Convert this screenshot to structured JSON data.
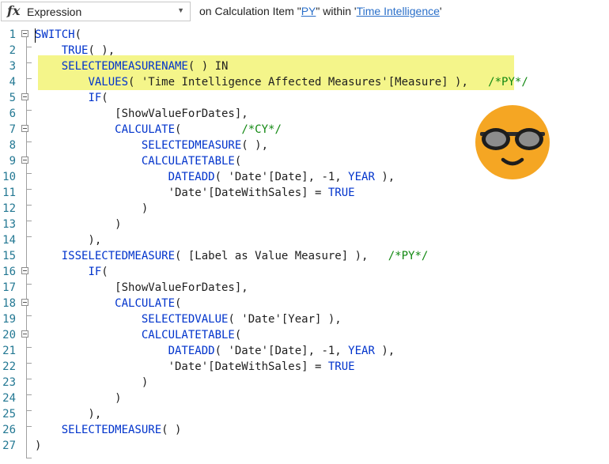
{
  "header": {
    "dropdown_label": "Expression",
    "context_prefix": "on Calculation Item \"",
    "item_name": "PY",
    "context_middle": "\" within '",
    "group_name": "Time Intelligence",
    "context_suffix": "'"
  },
  "editor": {
    "highlight_color": "#f4f58a",
    "lines": [
      {
        "n": "1",
        "t": [
          {
            "k": "kw",
            "s": "SWITCH"
          },
          {
            "s": "("
          }
        ]
      },
      {
        "n": "2",
        "t": [
          {
            "s": "    "
          },
          {
            "k": "kw",
            "s": "TRUE"
          },
          {
            "s": "( ),"
          }
        ]
      },
      {
        "n": "3",
        "t": [
          {
            "s": "    "
          },
          {
            "k": "kw",
            "s": "SELECTEDMEASURENAME"
          },
          {
            "s": "( ) IN"
          }
        ]
      },
      {
        "n": "4",
        "t": [
          {
            "s": "        "
          },
          {
            "k": "kw",
            "s": "VALUES"
          },
          {
            "s": "( 'Time Intelligence Affected Measures'[Measure] ),   "
          },
          {
            "k": "cm",
            "s": "/*PY*/"
          }
        ]
      },
      {
        "n": "5",
        "t": [
          {
            "s": "        "
          },
          {
            "k": "kw",
            "s": "IF"
          },
          {
            "s": "("
          }
        ]
      },
      {
        "n": "6",
        "t": [
          {
            "s": "            [ShowValueForDates],"
          }
        ]
      },
      {
        "n": "7",
        "t": [
          {
            "s": "            "
          },
          {
            "k": "kw",
            "s": "CALCULATE"
          },
          {
            "s": "(         "
          },
          {
            "k": "cm",
            "s": "/*CY*/"
          }
        ]
      },
      {
        "n": "8",
        "t": [
          {
            "s": "                "
          },
          {
            "k": "kw",
            "s": "SELECTEDMEASURE"
          },
          {
            "s": "( ),"
          }
        ]
      },
      {
        "n": "9",
        "t": [
          {
            "s": "                "
          },
          {
            "k": "kw",
            "s": "CALCULATETABLE"
          },
          {
            "s": "("
          }
        ]
      },
      {
        "n": "10",
        "t": [
          {
            "s": "                    "
          },
          {
            "k": "kw",
            "s": "DATEADD"
          },
          {
            "s": "( 'Date'[Date], -1, "
          },
          {
            "k": "kw",
            "s": "YEAR"
          },
          {
            "s": " ),"
          }
        ]
      },
      {
        "n": "11",
        "t": [
          {
            "s": "                    'Date'[DateWithSales] = "
          },
          {
            "k": "kw",
            "s": "TRUE"
          }
        ]
      },
      {
        "n": "12",
        "t": [
          {
            "s": "                )"
          }
        ]
      },
      {
        "n": "13",
        "t": [
          {
            "s": "            )"
          }
        ]
      },
      {
        "n": "14",
        "t": [
          {
            "s": "        ),"
          }
        ]
      },
      {
        "n": "15",
        "t": [
          {
            "s": "    "
          },
          {
            "k": "kw",
            "s": "ISSELECTEDMEASURE"
          },
          {
            "s": "( [Label as Value Measure] ),   "
          },
          {
            "k": "cm",
            "s": "/*PY*/"
          }
        ]
      },
      {
        "n": "16",
        "t": [
          {
            "s": "        "
          },
          {
            "k": "kw",
            "s": "IF"
          },
          {
            "s": "("
          }
        ]
      },
      {
        "n": "17",
        "t": [
          {
            "s": "            [ShowValueForDates],"
          }
        ]
      },
      {
        "n": "18",
        "t": [
          {
            "s": "            "
          },
          {
            "k": "kw",
            "s": "CALCULATE"
          },
          {
            "s": "("
          }
        ]
      },
      {
        "n": "19",
        "t": [
          {
            "s": "                "
          },
          {
            "k": "kw",
            "s": "SELECTEDVALUE"
          },
          {
            "s": "( 'Date'[Year] ),"
          }
        ]
      },
      {
        "n": "20",
        "t": [
          {
            "s": "                "
          },
          {
            "k": "kw",
            "s": "CALCULATETABLE"
          },
          {
            "s": "("
          }
        ]
      },
      {
        "n": "21",
        "t": [
          {
            "s": "                    "
          },
          {
            "k": "kw",
            "s": "DATEADD"
          },
          {
            "s": "( 'Date'[Date], -1, "
          },
          {
            "k": "kw",
            "s": "YEAR"
          },
          {
            "s": " ),"
          }
        ]
      },
      {
        "n": "22",
        "t": [
          {
            "s": "                    'Date'[DateWithSales] = "
          },
          {
            "k": "kw",
            "s": "TRUE"
          }
        ]
      },
      {
        "n": "23",
        "t": [
          {
            "s": "                )"
          }
        ]
      },
      {
        "n": "24",
        "t": [
          {
            "s": "            )"
          }
        ]
      },
      {
        "n": "25",
        "t": [
          {
            "s": "        ),"
          }
        ]
      },
      {
        "n": "26",
        "t": [
          {
            "s": "    "
          },
          {
            "k": "kw",
            "s": "SELECTEDMEASURE"
          },
          {
            "s": "( )"
          }
        ]
      },
      {
        "n": "27",
        "t": [
          {
            "s": ")"
          }
        ]
      }
    ]
  },
  "icons": {
    "fx": "fx",
    "emoji": "sunglasses-smiley-icon",
    "emoji_color": "#f5a623"
  }
}
